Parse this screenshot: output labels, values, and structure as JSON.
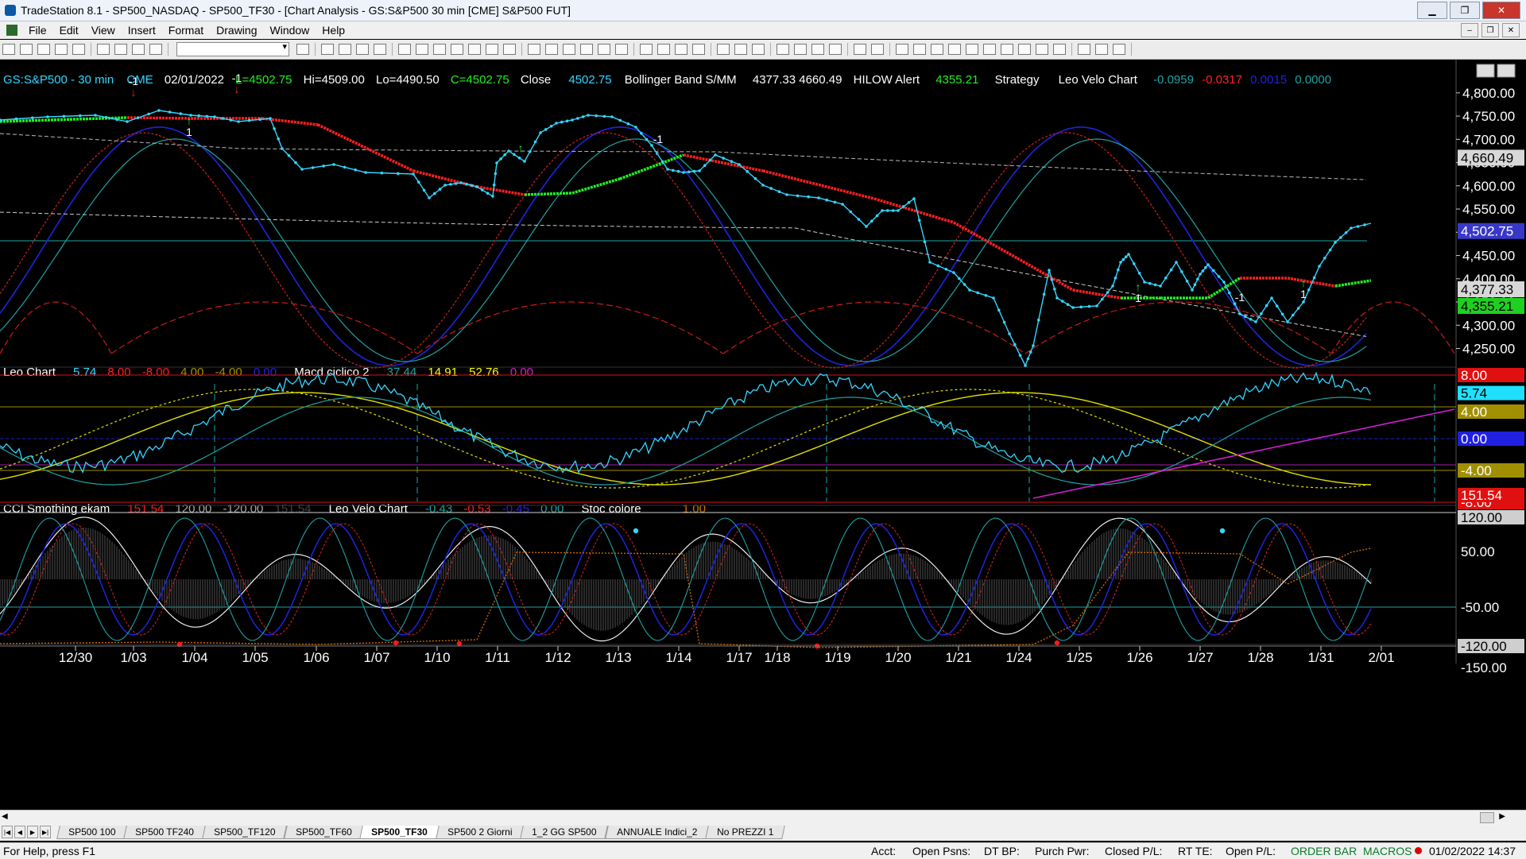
{
  "window": {
    "title": "TradeStation 8.1 - SP500_NASDAQ - SP500_TF30 - [Chart Analysis - GS:S&P500  30 min  [CME] S&P500 FUT]"
  },
  "menu": [
    "File",
    "Edit",
    "View",
    "Insert",
    "Format",
    "Drawing",
    "Window",
    "Help"
  ],
  "header": {
    "symbol": "GS:S&P500 - 30 min",
    "exchange": "CME",
    "date": "02/01/2022",
    "last": "L=4502.75",
    "high": "Hi=4509.00",
    "low": "Lo=4490.50",
    "close": "C=4502.75",
    "close_label": "Close",
    "close_val": "4502.75",
    "bb_label": "Bollinger Band S/MM",
    "bb_val": "4377.33  4660.49",
    "hilow_label": "HILOW Alert",
    "hilow_val": "4355.21",
    "strategy_label": "Strategy",
    "velo_label": "Leo Velo Chart",
    "velo_v1": "-0.0959",
    "velo_v2": "-0.0317",
    "velo_v3": "0.0015",
    "velo_v4": "0.0000"
  },
  "panel2": {
    "name": "Leo Chart",
    "v1": "5.74",
    "v2": "8.00",
    "v3": "-8.00",
    "v4": "4.00",
    "v5": "-4.00",
    "v6": "0.00",
    "macd_name": "Macd ciclico 2",
    "m1": "37.44",
    "m2": "14.91",
    "m3": "52.76",
    "m4": "0.00"
  },
  "panel3": {
    "name": "CCI Smothing ekam",
    "c1": "151.54",
    "c2": "120.00",
    "c3": "-120.00",
    "c4": "151.54",
    "velo_name": "Leo Velo Chart",
    "l1": "-0.43",
    "l2": "-0.53",
    "l3": "-0.45",
    "l4": "0.00",
    "stoc_name": "Stoc colore",
    "s1": "1.00"
  },
  "price_axis": [
    "4,800.00",
    "4,750.00",
    "4,700.00",
    "4,650.00",
    "4,600.00",
    "4,550.00",
    "4,500.00",
    "4,450.00",
    "4,400.00",
    "4,350.00",
    "4,300.00",
    "4,250.00"
  ],
  "price_tags": {
    "upper": "4,660.49",
    "last": "4,502.75",
    "lower": "4,377.33",
    "hilow": "4,355.21"
  },
  "osc_tags": {
    "p8": "8.00",
    "cur": "5.74",
    "p4": "4.00",
    "z": "0.00",
    "m4": "-4.00",
    "m8": "-8.00"
  },
  "cci_tags": {
    "cur": "151.54",
    "p120": "120.00",
    "p50": "50.00",
    "m50": "-50.00",
    "m120": "-120.00",
    "m150": "-150.00"
  },
  "markers": {
    "m1": "-1",
    "p1": "1",
    "up": "↑",
    "down": "↓"
  },
  "dates": [
    "12/30",
    "1/03",
    "1/04",
    "1/05",
    "1/06",
    "1/07",
    "1/10",
    "1/11",
    "1/12",
    "1/13",
    "1/14",
    "1/17",
    "1/18",
    "1/19",
    "1/20",
    "1/21",
    "1/24",
    "1/25",
    "1/26",
    "1/27",
    "1/28",
    "1/31",
    "2/01"
  ],
  "tabs": [
    "SP500 100",
    "SP500 TF240",
    "SP500_TF120",
    "SP500_TF60",
    "SP500_TF30",
    "SP500 2 Giorni",
    "1_2 GG SP500",
    "ANNUALE Indici_2",
    "No PREZZI 1"
  ],
  "active_tab": "SP500_TF30",
  "status": {
    "help": "For Help, press F1",
    "acct": "Acct:",
    "open_psns": "Open Psns:",
    "dt_bp": "DT BP:",
    "purch_pwr": "Purch Pwr:",
    "closed_pl": "Closed P/L:",
    "rt_te": "RT TE:",
    "open_pl": "Open P/L:",
    "order_bar": "ORDER BAR",
    "macros": "MACROS",
    "datetime": "01/02/2022 14:37"
  },
  "colors": {
    "price": "#33d6ff",
    "bull": "#22ee22",
    "bear": "#ff2020",
    "blue": "#2222dd",
    "teal": "#1fa3a3",
    "yellow": "#ffff00",
    "magenta": "#d020d0"
  }
}
